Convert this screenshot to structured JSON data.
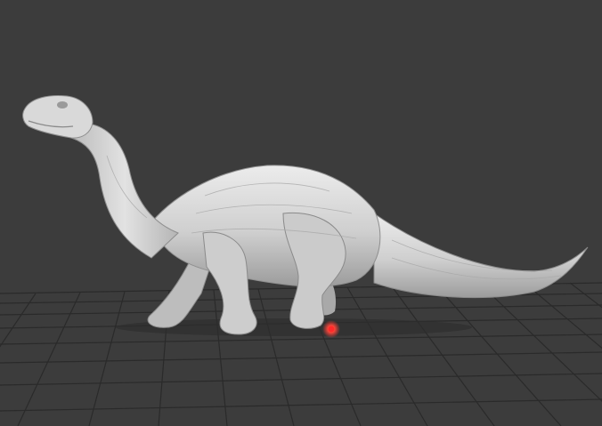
{
  "viewport": {
    "background_color": "#3c3c3c",
    "grid_color": "#2a2a2a",
    "model_color": "#d6d6d6",
    "model_shadow_color": "#8f8f8f",
    "marker_color": "#ff3b3b"
  },
  "model": {
    "icon": "dinosaur-model-icon"
  },
  "marker": {
    "icon": "red-point-marker-icon"
  }
}
